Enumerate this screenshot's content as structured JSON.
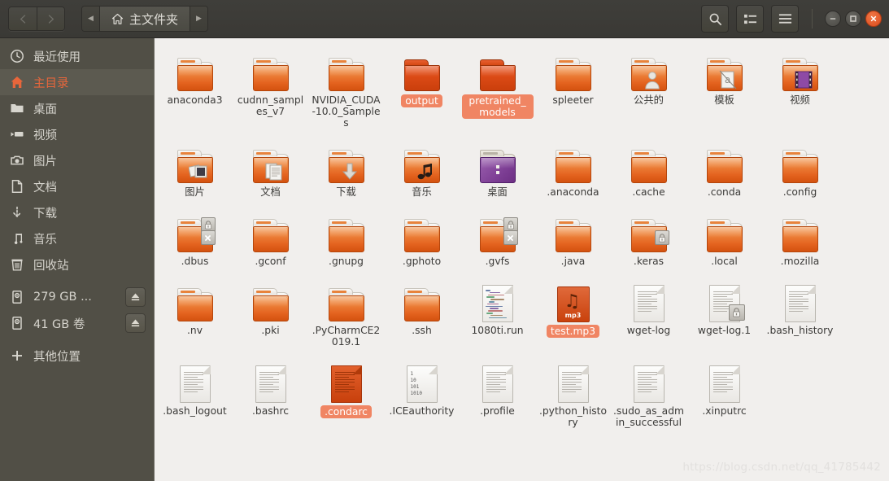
{
  "window": {
    "title": "主文件夹",
    "nav": {
      "back": "back-arrow",
      "forward": "forward-arrow"
    },
    "path_prev": "◀",
    "path_next": "▶",
    "home_icon": "home-icon",
    "toolbar": {
      "search_label": "search-icon",
      "view_label": "view-list-icon",
      "menu_label": "hamburger-menu-icon"
    },
    "controls": {
      "minimize": "—",
      "maximize": "□",
      "close": "✕"
    }
  },
  "sidebar": {
    "items": [
      {
        "label": "最近使用",
        "icon": "clock-icon",
        "active": false,
        "eject": false
      },
      {
        "label": "主目录",
        "icon": "home-icon",
        "active": true,
        "eject": false
      },
      {
        "label": "桌面",
        "icon": "folder-icon",
        "active": false,
        "eject": false
      },
      {
        "label": "视频",
        "icon": "video-icon",
        "active": false,
        "eject": false
      },
      {
        "label": "图片",
        "icon": "camera-icon",
        "active": false,
        "eject": false
      },
      {
        "label": "文档",
        "icon": "document-icon",
        "active": false,
        "eject": false
      },
      {
        "label": "下载",
        "icon": "download-icon",
        "active": false,
        "eject": false
      },
      {
        "label": "音乐",
        "icon": "music-icon",
        "active": false,
        "eject": false
      },
      {
        "label": "回收站",
        "icon": "trash-icon",
        "active": false,
        "eject": false
      },
      {
        "label": "279 GB ...",
        "icon": "drive-icon",
        "active": false,
        "eject": true
      },
      {
        "label": "41 GB 卷",
        "icon": "drive-icon",
        "active": false,
        "eject": true
      },
      {
        "label": "其他位置",
        "icon": "plus-icon",
        "active": false,
        "eject": false
      }
    ]
  },
  "files": [
    {
      "name": "anaconda3",
      "kind": "folder",
      "selected": false
    },
    {
      "name": "cudnn_samples_v7",
      "kind": "folder",
      "selected": false
    },
    {
      "name": "NVIDIA_CUDA-10.0_Samples",
      "kind": "folder",
      "selected": false
    },
    {
      "name": "output",
      "kind": "folder-dark",
      "selected": true
    },
    {
      "name": "pretrained_models",
      "kind": "folder-dark",
      "selected": true
    },
    {
      "name": "spleeter",
      "kind": "folder",
      "selected": false
    },
    {
      "name": "公共的",
      "kind": "folder-public",
      "selected": false
    },
    {
      "name": "模板",
      "kind": "folder-template",
      "selected": false
    },
    {
      "name": "视频",
      "kind": "folder-videos",
      "selected": false
    },
    {
      "name": "图片",
      "kind": "folder-pictures",
      "selected": false
    },
    {
      "name": "文档",
      "kind": "folder-documents",
      "selected": false
    },
    {
      "name": "下载",
      "kind": "folder-downloads",
      "selected": false
    },
    {
      "name": "音乐",
      "kind": "folder-music",
      "selected": false
    },
    {
      "name": "桌面",
      "kind": "folder-desktop",
      "selected": false
    },
    {
      "name": ".anaconda",
      "kind": "folder",
      "selected": false
    },
    {
      "name": ".cache",
      "kind": "folder",
      "selected": false
    },
    {
      "name": ".conda",
      "kind": "folder",
      "selected": false
    },
    {
      "name": ".config",
      "kind": "folder",
      "selected": false
    },
    {
      "name": ".dbus",
      "kind": "folder-lock-x",
      "selected": false
    },
    {
      "name": ".gconf",
      "kind": "folder",
      "selected": false
    },
    {
      "name": ".gnupg",
      "kind": "folder",
      "selected": false
    },
    {
      "name": ".gphoto",
      "kind": "folder",
      "selected": false
    },
    {
      "name": ".gvfs",
      "kind": "folder-lock-x",
      "selected": false
    },
    {
      "name": ".java",
      "kind": "folder",
      "selected": false
    },
    {
      "name": ".keras",
      "kind": "folder-lock",
      "selected": false
    },
    {
      "name": ".local",
      "kind": "folder",
      "selected": false
    },
    {
      "name": ".mozilla",
      "kind": "folder",
      "selected": false
    },
    {
      "name": ".nv",
      "kind": "folder",
      "selected": false
    },
    {
      "name": ".pki",
      "kind": "folder",
      "selected": false
    },
    {
      "name": ".PyCharmCE2019.1",
      "kind": "folder",
      "selected": false
    },
    {
      "name": ".ssh",
      "kind": "folder",
      "selected": false
    },
    {
      "name": "1080ti.run",
      "kind": "run",
      "selected": false
    },
    {
      "name": "test.mp3",
      "kind": "mp3",
      "selected": true
    },
    {
      "name": "wget-log",
      "kind": "doc",
      "selected": false
    },
    {
      "name": "wget-log.1",
      "kind": "doc-lock",
      "selected": false
    },
    {
      "name": ".bash_history",
      "kind": "doc",
      "selected": false
    },
    {
      "name": ".bash_logout",
      "kind": "doc",
      "selected": false
    },
    {
      "name": ".bashrc",
      "kind": "doc",
      "selected": false
    },
    {
      "name": ".condarc",
      "kind": "doc-red",
      "selected": true
    },
    {
      "name": ".ICEauthority",
      "kind": "doc-bin",
      "selected": false
    },
    {
      "name": ".profile",
      "kind": "doc",
      "selected": false
    },
    {
      "name": ".python_history",
      "kind": "doc",
      "selected": false
    },
    {
      "name": ".sudo_as_admin_successful",
      "kind": "doc",
      "selected": false
    },
    {
      "name": ".xinputrc",
      "kind": "doc",
      "selected": false
    }
  ],
  "watermark": "https://blog.csdn.net/qq_41785442",
  "colors": {
    "accent": "#e8663b",
    "selection": "#f08563",
    "sidebar_bg": "#514f46",
    "header_bg": "#3f3e3a",
    "content_bg": "#f1efed",
    "folder_orange": "#e4631f",
    "close_red": "#dc4b1c"
  },
  "binary_preview": [
    "1",
    "10",
    "101",
    "1010"
  ]
}
